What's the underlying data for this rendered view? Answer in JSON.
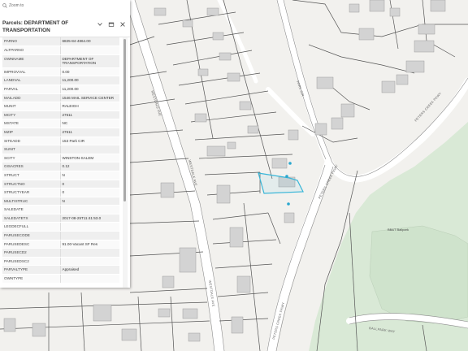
{
  "popup": {
    "zoom_label": "Zoom to",
    "title": "Parcels: DEPARTMENT OF TRANSPORTATION",
    "attributes": [
      {
        "key": "PARNO",
        "value": "6825-84-4864.00"
      },
      {
        "key": "ALTPARNO",
        "value": ""
      },
      {
        "key": "OWNNAME",
        "value": "DEPARTMENT OF TRANSPORTATION"
      },
      {
        "key": "IMPROVVAL",
        "value": "0.00"
      },
      {
        "key": "LANDVAL",
        "value": "11,200.00"
      },
      {
        "key": "PARVAL",
        "value": "11,200.00"
      },
      {
        "key": "MAILADD",
        "value": "1546 MAIL SERVICE CENTER"
      },
      {
        "key": "MUNIT",
        "value": "RALEIGH"
      },
      {
        "key": "MCITY",
        "value": "27611"
      },
      {
        "key": "MSTATE",
        "value": "NC"
      },
      {
        "key": "MZIP",
        "value": "27611"
      },
      {
        "key": "SITEADD",
        "value": "153 Park CIR"
      },
      {
        "key": "SUNIT",
        "value": ""
      },
      {
        "key": "SCITY",
        "value": "WINSTON-SALEM"
      },
      {
        "key": "GISACRES",
        "value": "0.12"
      },
      {
        "key": "STRUCT",
        "value": "N"
      },
      {
        "key": "STRUCTNO",
        "value": "0"
      },
      {
        "key": "STRUCTYEAR",
        "value": "0"
      },
      {
        "key": "MULTISTRUC",
        "value": "N"
      },
      {
        "key": "SALEDATE",
        "value": ""
      },
      {
        "key": "SALEDATETX",
        "value": "2017-08-25T11:41:53.0"
      },
      {
        "key": "LEGDECFULL",
        "value": ""
      },
      {
        "key": "PARUSECODE",
        "value": ""
      },
      {
        "key": "PARUSEDESC",
        "value": "91.00-Vacant SF Res"
      },
      {
        "key": "PARUSECD2",
        "value": ""
      },
      {
        "key": "PARUSEDSC2",
        "value": ""
      },
      {
        "key": "PARVALTYPE",
        "value": "Appraised"
      },
      {
        "key": "OWNTYPE",
        "value": ""
      }
    ]
  },
  "map": {
    "labels": {
      "westdale_upper": "WESTDALE AVE",
      "westdale_mid": "WESTDALE AVE",
      "westdale_lower": "WESTDALE AVE",
      "park_cir": "PARK CIR",
      "peters_creek_upper": "PETERS CREEK PKWY",
      "peters_creek_mid": "PETERS CREEK PKWY",
      "peters_creek_lower": "PETERS CREEK PKWY",
      "ballpark_way": "BALLPARK WAY",
      "bb_t_ballpark": "BB&T Ballpark"
    },
    "colors": {
      "background": "#f2f1ee",
      "green_area": "#dbeadb",
      "parcel_line": "#4d4d4d",
      "building_fill": "#d3d3d3",
      "selection": "#39b6d8"
    }
  }
}
